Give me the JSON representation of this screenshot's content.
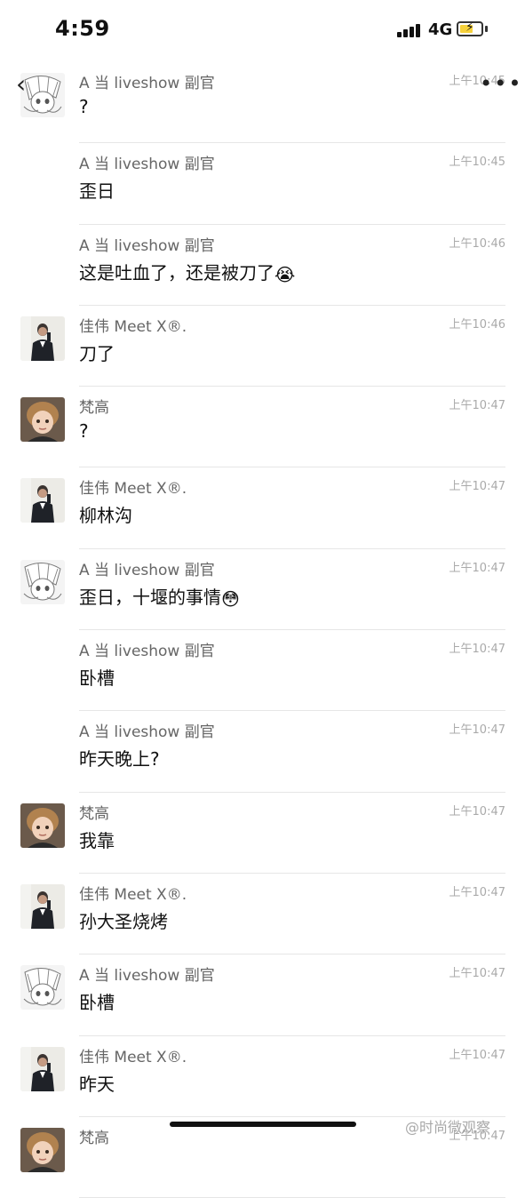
{
  "status_bar": {
    "time": "4:59",
    "network": "4G"
  },
  "icons": {
    "back": "chevron-left-icon",
    "more": "more-dots-icon",
    "battery": "battery-charging-icon",
    "signal": "signal-icon"
  },
  "messages": [
    {
      "sender": "A   当 liveshow 副官",
      "time": "上午10:45",
      "text": "?",
      "avatar": "anime"
    },
    {
      "sender": "A   当 liveshow 副官",
      "time": "上午10:45",
      "text": "歪日",
      "avatar": ""
    },
    {
      "sender": "A   当 liveshow 副官",
      "time": "上午10:46",
      "text": "这是吐血了，还是被刀了",
      "emoji": "😭",
      "avatar": ""
    },
    {
      "sender": "佳伟 Meet X®.",
      "time": "上午10:46",
      "text": "刀了",
      "avatar": "man"
    },
    {
      "sender": "梵高",
      "time": "上午10:47",
      "text": "?",
      "avatar": "child"
    },
    {
      "sender": "佳伟 Meet X®.",
      "time": "上午10:47",
      "text": "柳林沟",
      "avatar": "man"
    },
    {
      "sender": "A   当 liveshow 副官",
      "time": "上午10:47",
      "text": "歪日，十堰的事情",
      "emoji": "😳",
      "avatar": "anime"
    },
    {
      "sender": "A   当 liveshow 副官",
      "time": "上午10:47",
      "text": "卧槽",
      "avatar": ""
    },
    {
      "sender": "A   当 liveshow 副官",
      "time": "上午10:47",
      "text": "昨天晚上?",
      "avatar": ""
    },
    {
      "sender": "梵高",
      "time": "上午10:47",
      "text": "我靠",
      "avatar": "child"
    },
    {
      "sender": "佳伟 Meet X®.",
      "time": "上午10:47",
      "text": "孙大圣烧烤",
      "avatar": "man"
    },
    {
      "sender": "A   当 liveshow 副官",
      "time": "上午10:47",
      "text": "卧槽",
      "avatar": "anime"
    },
    {
      "sender": "佳伟 Meet X®.",
      "time": "上午10:47",
      "text": "昨天",
      "avatar": "man"
    },
    {
      "sender": "梵高",
      "time": "上午10:47",
      "text": "",
      "avatar": "child"
    }
  ],
  "watermark": "@时尚微观察"
}
